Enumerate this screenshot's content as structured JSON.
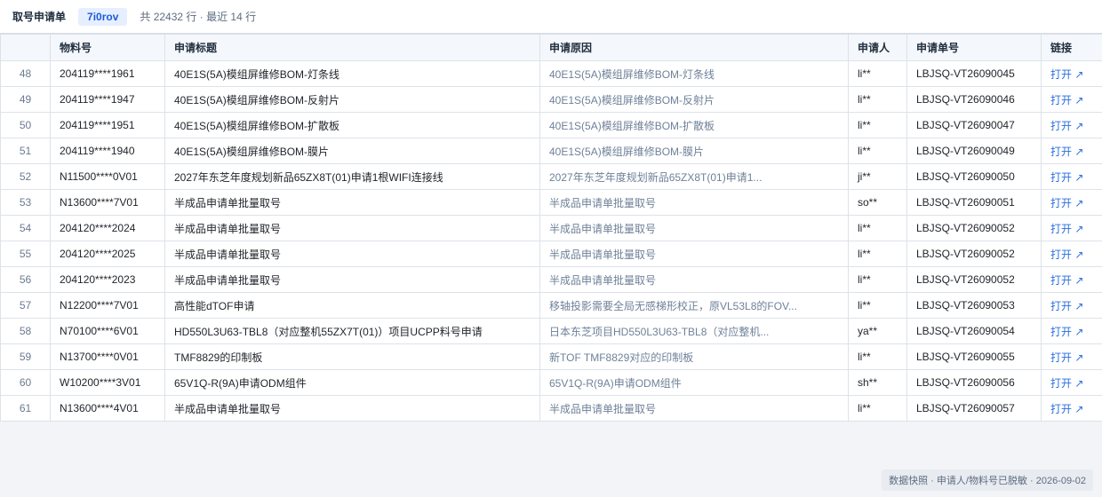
{
  "header": {
    "title": "取号申请单",
    "view_badge": "7i0rov",
    "meta": "共 22432 行 · 最近 14 行"
  },
  "columns": [
    "",
    "物料号",
    "申请标题",
    "申请原因",
    "申请人",
    "申请单号",
    "链接"
  ],
  "rows": [
    {
      "idx": "48",
      "material": "204119****1961",
      "title": "40E1S(5A)模组屏维修BOM-灯条线",
      "reason": "40E1S(5A)模组屏维修BOM-灯条线",
      "applicant": "li**",
      "number": "LBJSQ-VT26090045",
      "link": "打开 ↗"
    },
    {
      "idx": "49",
      "material": "204119****1947",
      "title": "40E1S(5A)模组屏维修BOM-反射片",
      "reason": "40E1S(5A)模组屏维修BOM-反射片",
      "applicant": "li**",
      "number": "LBJSQ-VT26090046",
      "link": "打开 ↗"
    },
    {
      "idx": "50",
      "material": "204119****1951",
      "title": "40E1S(5A)模组屏维修BOM-扩散板",
      "reason": "40E1S(5A)模组屏维修BOM-扩散板",
      "applicant": "li**",
      "number": "LBJSQ-VT26090047",
      "link": "打开 ↗"
    },
    {
      "idx": "51",
      "material": "204119****1940",
      "title": "40E1S(5A)模组屏维修BOM-膜片",
      "reason": "40E1S(5A)模组屏维修BOM-膜片",
      "applicant": "li**",
      "number": "LBJSQ-VT26090049",
      "link": "打开 ↗"
    },
    {
      "idx": "52",
      "material": "N11500****0V01",
      "title": "2027年东芝年度规划新品65ZX8T(01)申请1根WIFI连接线",
      "reason": "2027年东芝年度规划新品65ZX8T(01)申请1...",
      "applicant": "ji**",
      "number": "LBJSQ-VT26090050",
      "link": "打开 ↗"
    },
    {
      "idx": "53",
      "material": "N13600****7V01",
      "title": "半成品申请单批量取号",
      "reason": "半成品申请单批量取号",
      "applicant": "so**",
      "number": "LBJSQ-VT26090051",
      "link": "打开 ↗"
    },
    {
      "idx": "54",
      "material": "204120****2024",
      "title": "半成品申请单批量取号",
      "reason": "半成品申请单批量取号",
      "applicant": "li**",
      "number": "LBJSQ-VT26090052",
      "link": "打开 ↗"
    },
    {
      "idx": "55",
      "material": "204120****2025",
      "title": "半成品申请单批量取号",
      "reason": "半成品申请单批量取号",
      "applicant": "li**",
      "number": "LBJSQ-VT26090052",
      "link": "打开 ↗"
    },
    {
      "idx": "56",
      "material": "204120****2023",
      "title": "半成品申请单批量取号",
      "reason": "半成品申请单批量取号",
      "applicant": "li**",
      "number": "LBJSQ-VT26090052",
      "link": "打开 ↗"
    },
    {
      "idx": "57",
      "material": "N12200****7V01",
      "title": "高性能dTOF申请",
      "reason": "移轴投影需要全局无感梯形校正，原VL53L8的FOV...",
      "applicant": "li**",
      "number": "LBJSQ-VT26090053",
      "link": "打开 ↗"
    },
    {
      "idx": "58",
      "material": "N70100****6V01",
      "title": "HD550L3U63-TBL8（对应整机55ZX7T(01)）项目UCPP料号申请",
      "reason": "日本东芝项目HD550L3U63-TBL8（对应整机...",
      "applicant": "ya**",
      "number": "LBJSQ-VT26090054",
      "link": "打开 ↗"
    },
    {
      "idx": "59",
      "material": "N13700****0V01",
      "title": "TMF8829的印制板",
      "reason": "新TOF TMF8829对应的印制板",
      "applicant": "li**",
      "number": "LBJSQ-VT26090055",
      "link": "打开 ↗"
    },
    {
      "idx": "60",
      "material": "W10200****3V01",
      "title": "65V1Q-R(9A)申请ODM组件",
      "reason": "65V1Q-R(9A)申请ODM组件",
      "applicant": "sh**",
      "number": "LBJSQ-VT26090056",
      "link": "打开 ↗"
    },
    {
      "idx": "61",
      "material": "N13600****4V01",
      "title": "半成品申请单批量取号",
      "reason": "半成品申请单批量取号",
      "applicant": "li**",
      "number": "LBJSQ-VT26090057",
      "link": "打开 ↗"
    }
  ],
  "footer": {
    "note": "数据快照 · 申请人/物料号已脱敏 · 2026-09-02"
  }
}
